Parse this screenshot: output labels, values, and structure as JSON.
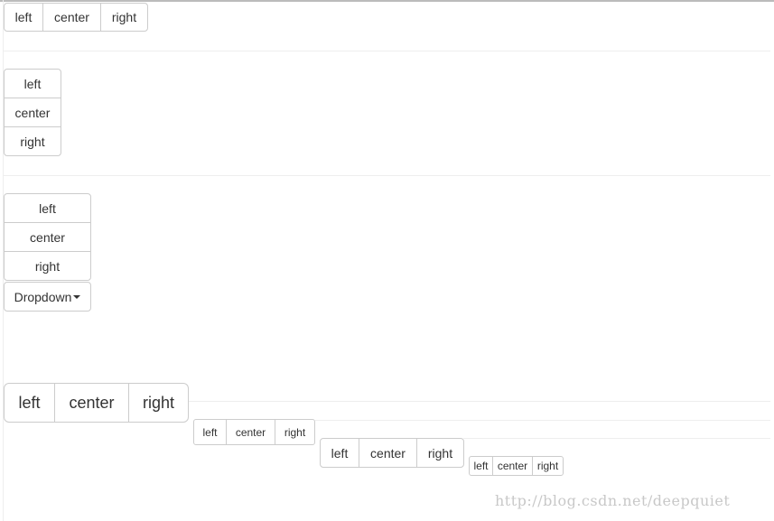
{
  "groups": {
    "horizontal_default": [
      "left",
      "center",
      "right"
    ],
    "vertical": [
      "left",
      "center",
      "right"
    ],
    "vertical_dropdown": [
      "left",
      "center",
      "right"
    ],
    "dropdown_label": "Dropdown",
    "large": [
      "left",
      "center",
      "right"
    ],
    "small": [
      "left",
      "center",
      "right"
    ],
    "default": [
      "left",
      "center",
      "right"
    ],
    "xsmall": [
      "left",
      "center",
      "right"
    ]
  },
  "watermark": "http://blog.csdn.net/deepquiet"
}
